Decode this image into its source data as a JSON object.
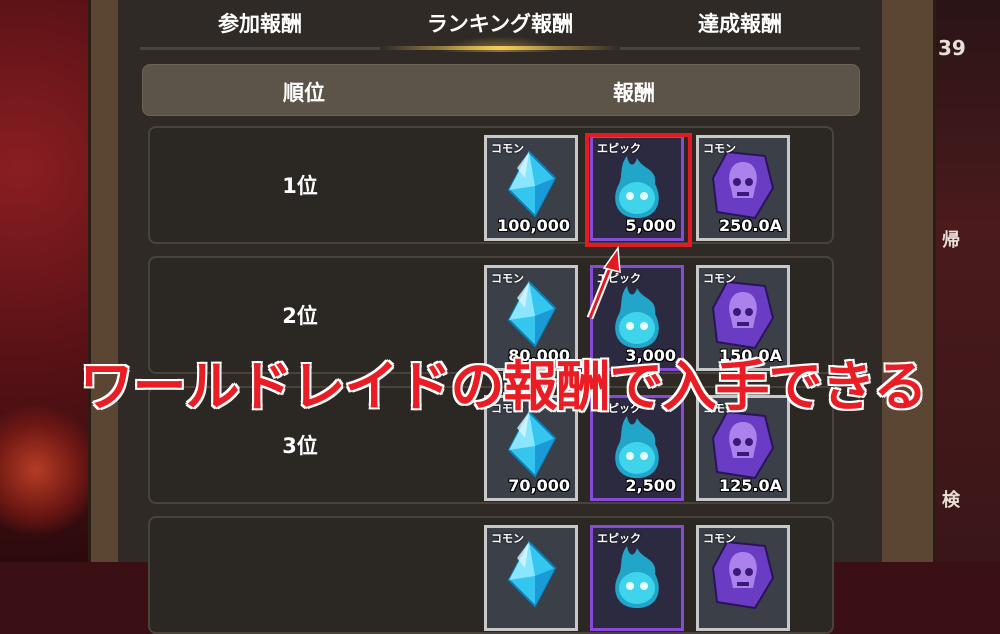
{
  "tabs": [
    {
      "label": "参加報酬",
      "active": false
    },
    {
      "label": "ランキング報酬",
      "active": true
    },
    {
      "label": "達成報酬",
      "active": false
    }
  ],
  "table_header": {
    "rank": "順位",
    "reward": "報酬"
  },
  "rows": [
    {
      "rank": "1位",
      "rewards": [
        {
          "tag": "コモン",
          "qty": "100,000",
          "icon": "blue-crystal-icon",
          "rarity": "common"
        },
        {
          "tag": "エピック",
          "qty": "5,000",
          "icon": "blue-spirit-flame-icon",
          "rarity": "epic"
        },
        {
          "tag": "コモン",
          "qty": "250.0A",
          "icon": "purple-skull-stone-icon",
          "rarity": "common"
        }
      ]
    },
    {
      "rank": "2位",
      "rewards": [
        {
          "tag": "コモン",
          "qty": "80,000",
          "icon": "blue-crystal-icon",
          "rarity": "common"
        },
        {
          "tag": "エピック",
          "qty": "3,000",
          "icon": "blue-spirit-flame-icon",
          "rarity": "epic"
        },
        {
          "tag": "コモン",
          "qty": "150.0A",
          "icon": "purple-skull-stone-icon",
          "rarity": "common"
        }
      ]
    },
    {
      "rank": "3位",
      "rewards": [
        {
          "tag": "コモン",
          "qty": "70,000",
          "icon": "blue-crystal-icon",
          "rarity": "common"
        },
        {
          "tag": "エピック",
          "qty": "2,500",
          "icon": "blue-spirit-flame-icon",
          "rarity": "epic"
        },
        {
          "tag": "コモン",
          "qty": "125.0A",
          "icon": "purple-skull-stone-icon",
          "rarity": "common"
        }
      ]
    },
    {
      "rank": "",
      "rewards": [
        {
          "tag": "コモン",
          "qty": "",
          "icon": "blue-crystal-icon",
          "rarity": "common"
        },
        {
          "tag": "エピック",
          "qty": "",
          "icon": "blue-spirit-flame-icon",
          "rarity": "epic"
        },
        {
          "tag": "コモン",
          "qty": "",
          "icon": "purple-skull-stone-icon",
          "rarity": "common"
        }
      ]
    }
  ],
  "annotation": {
    "caption": "ワールドレイドの報酬で入手できる",
    "color": "#ea1c24"
  },
  "side": {
    "counter_fragment": "39",
    "char_1": "帰",
    "char_2": "検"
  },
  "colors": {
    "epic_border": "#8a4ad8",
    "common_border": "#c8c8c8",
    "tab_active": "#f3c85a"
  }
}
